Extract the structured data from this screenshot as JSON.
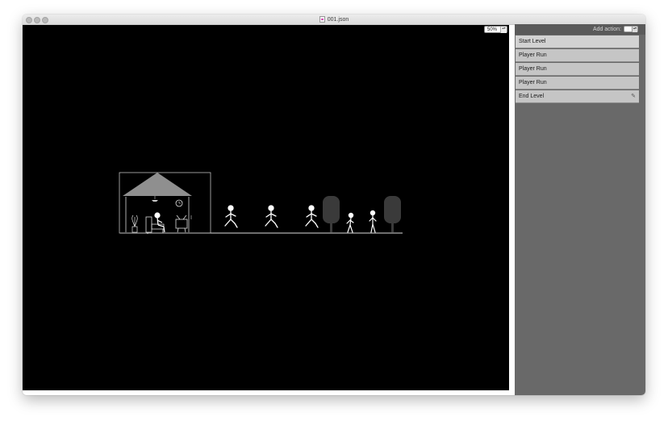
{
  "window": {
    "title": "001.json",
    "title_icon": "json-document-icon"
  },
  "canvas": {
    "zoom": {
      "value": "50%",
      "stepper_glyph": "▴▾"
    },
    "background": "#000000",
    "scene": {
      "description_icons": [
        "house-icon",
        "clock-icon",
        "plant-icon",
        "armchair-icon",
        "tv-icon",
        "running-figure-icon",
        "standing-figure-icon",
        "tree-icon"
      ]
    }
  },
  "panel": {
    "add_action_label": "Add action:",
    "add_action_stepper": "▴▾",
    "actions": [
      {
        "label": "Start Level"
      },
      {
        "label": "Player Run"
      },
      {
        "label": "Player Run"
      },
      {
        "label": "Player Run"
      },
      {
        "label": "End Level",
        "edit_icon": "✎"
      }
    ]
  },
  "colors": {
    "panel_bg": "#696969",
    "action_bg": "#c5c5c5",
    "canvas_bg": "#000000"
  }
}
